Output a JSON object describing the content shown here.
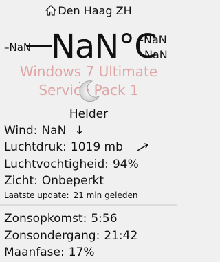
{
  "header": {
    "location": "Den Haag ZH"
  },
  "temperature": {
    "current": "NaN°C",
    "left_small": "NaN",
    "right_small_top": "NaN",
    "right_small_bottom": "NaN"
  },
  "watermark": {
    "line1": "Windows 7 Ultimate",
    "line2": "Service Pack 1"
  },
  "condition": {
    "label": "Helder",
    "icon": "moon-icon"
  },
  "details": {
    "wind_label": "Wind:",
    "wind_value": "NaN",
    "wind_arrow": "↓",
    "pressure_label": "Luchtdruk:",
    "pressure_value": "1019 mb",
    "humidity_label": "Luchtvochtigheid:",
    "humidity_value": "94%",
    "visibility_label": "Zicht:",
    "visibility_value": "Onbeperkt",
    "updated_label": "Laatste update:",
    "updated_value": "21 min geleden"
  },
  "astro": {
    "sunrise_label": "Zonsopkomst:",
    "sunrise_value": "5:56",
    "sunset_label": "Zonsondergang:",
    "sunset_value": "21:42",
    "moonphase_label": "Maanfase:",
    "moonphase_value": "17%"
  }
}
